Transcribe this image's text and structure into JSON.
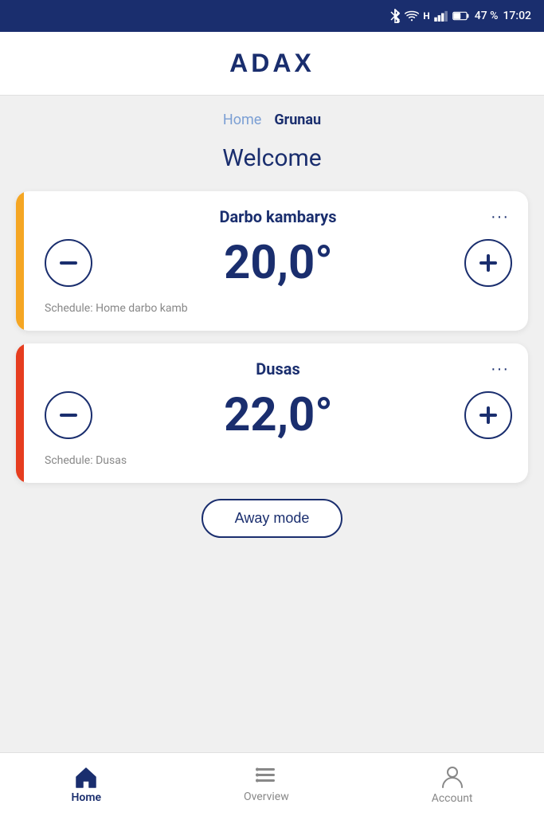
{
  "statusBar": {
    "battery": "47 %",
    "time": "17:02",
    "icons": [
      "bluetooth",
      "wifi",
      "signal",
      "battery"
    ]
  },
  "header": {
    "logo": "ADAX"
  },
  "breadcrumb": {
    "home": "Home",
    "current": "Grunau"
  },
  "welcome": "Welcome",
  "devices": [
    {
      "id": "darbo",
      "name": "Darbo kambarys",
      "temperature": "20,0°",
      "schedule": "Schedule: Home darbo kamb",
      "accent": "yellow"
    },
    {
      "id": "dusas",
      "name": "Dusas",
      "temperature": "22,0°",
      "schedule": "Schedule: Dusas",
      "accent": "orange"
    }
  ],
  "awayModeBtn": "Away mode",
  "bottomNav": {
    "items": [
      {
        "id": "home",
        "label": "Home",
        "active": true
      },
      {
        "id": "overview",
        "label": "Overview",
        "active": false
      },
      {
        "id": "account",
        "label": "Account",
        "active": false
      }
    ]
  }
}
